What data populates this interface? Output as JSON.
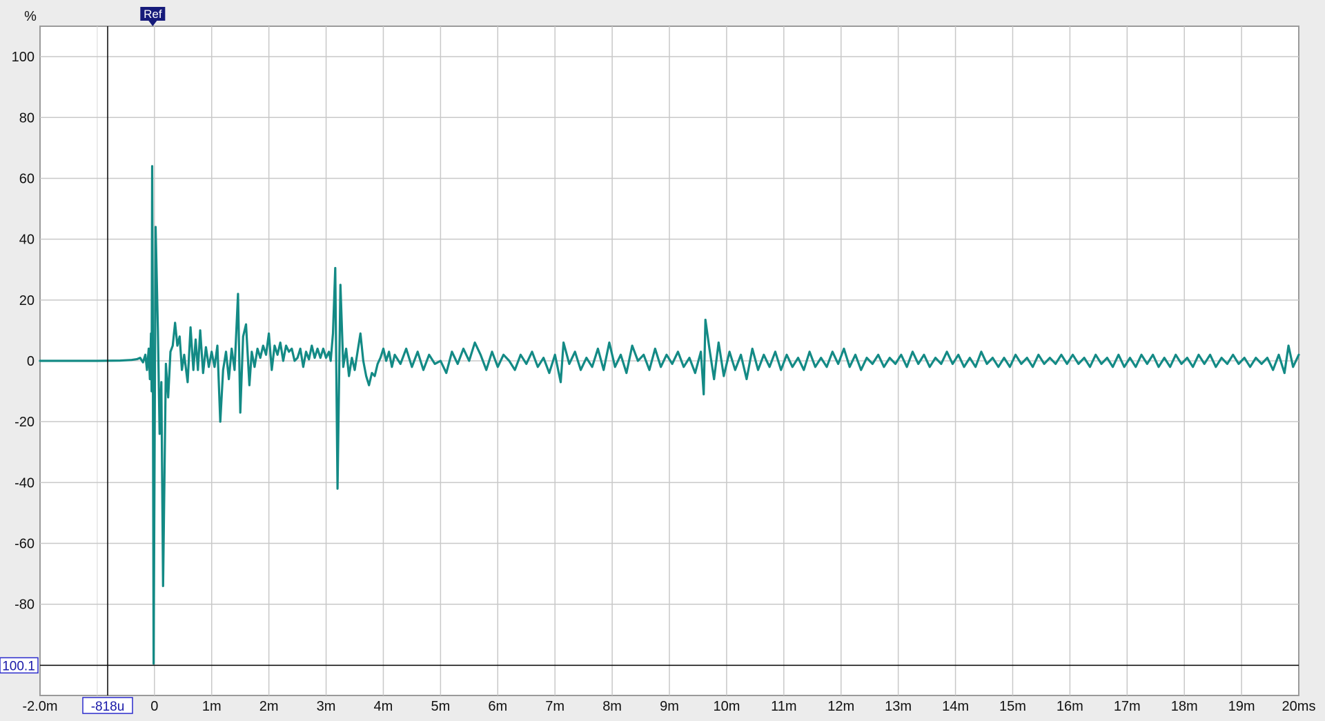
{
  "chart_data": {
    "type": "line",
    "title": "",
    "xlabel": "",
    "ylabel": "%",
    "xlim": [
      -2.0,
      20.0
    ],
    "ylim": [
      -110,
      110
    ],
    "grid": true,
    "x_unit": "ms",
    "x_ticks": [
      {
        "value": -2,
        "label": "-2.0m"
      },
      {
        "value": 0,
        "label": "0"
      },
      {
        "value": 1,
        "label": "1m"
      },
      {
        "value": 2,
        "label": "2m"
      },
      {
        "value": 3,
        "label": "3m"
      },
      {
        "value": 4,
        "label": "4m"
      },
      {
        "value": 5,
        "label": "5m"
      },
      {
        "value": 6,
        "label": "6m"
      },
      {
        "value": 7,
        "label": "7m"
      },
      {
        "value": 8,
        "label": "8m"
      },
      {
        "value": 9,
        "label": "9m"
      },
      {
        "value": 10,
        "label": "10m"
      },
      {
        "value": 11,
        "label": "11m"
      },
      {
        "value": 12,
        "label": "12m"
      },
      {
        "value": 13,
        "label": "13m"
      },
      {
        "value": 14,
        "label": "14m"
      },
      {
        "value": 15,
        "label": "15m"
      },
      {
        "value": 16,
        "label": "16m"
      },
      {
        "value": 17,
        "label": "17m"
      },
      {
        "value": 18,
        "label": "18m"
      },
      {
        "value": 19,
        "label": "19m"
      },
      {
        "value": 20,
        "label": "20ms"
      }
    ],
    "y_ticks": [
      {
        "value": 100,
        "label": "100"
      },
      {
        "value": 80,
        "label": "80"
      },
      {
        "value": 60,
        "label": "60"
      },
      {
        "value": 40,
        "label": "40"
      },
      {
        "value": 20,
        "label": "20"
      },
      {
        "value": 0,
        "label": "0"
      },
      {
        "value": -20,
        "label": "-20"
      },
      {
        "value": -40,
        "label": "-40"
      },
      {
        "value": -60,
        "label": "-60"
      },
      {
        "value": -80,
        "label": "-80"
      }
    ],
    "cursor": {
      "x_value": -0.818,
      "x_label": "-818u",
      "y_value": -100.1,
      "y_label": "100.1"
    },
    "reference_marker": {
      "x_value": -0.03,
      "label": "Ref"
    },
    "series": [
      {
        "color": "#138a85",
        "points": [
          [
            -2.0,
            0
          ],
          [
            -1.5,
            0
          ],
          [
            -1.0,
            0
          ],
          [
            -0.6,
            0.1
          ],
          [
            -0.4,
            0.3
          ],
          [
            -0.3,
            0.6
          ],
          [
            -0.25,
            1.0
          ],
          [
            -0.2,
            -0.5
          ],
          [
            -0.16,
            2.0
          ],
          [
            -0.13,
            -3.0
          ],
          [
            -0.1,
            4.0
          ],
          [
            -0.08,
            -6.0
          ],
          [
            -0.06,
            9.0
          ],
          [
            -0.05,
            -10.0
          ],
          [
            -0.04,
            64.0
          ],
          [
            -0.03,
            20.0
          ],
          [
            -0.015,
            -99.5
          ],
          [
            0.02,
            44.0
          ],
          [
            0.06,
            10.0
          ],
          [
            0.09,
            -24.0
          ],
          [
            0.12,
            -7.0
          ],
          [
            0.15,
            -74.0
          ],
          [
            0.2,
            -1.0
          ],
          [
            0.24,
            -12.0
          ],
          [
            0.28,
            3.0
          ],
          [
            0.32,
            5.0
          ],
          [
            0.36,
            12.5
          ],
          [
            0.4,
            5.0
          ],
          [
            0.44,
            8.0
          ],
          [
            0.48,
            -3.0
          ],
          [
            0.52,
            2.0
          ],
          [
            0.58,
            -7.0
          ],
          [
            0.63,
            11.0
          ],
          [
            0.68,
            -3.0
          ],
          [
            0.72,
            7.0
          ],
          [
            0.76,
            -3.0
          ],
          [
            0.8,
            10.0
          ],
          [
            0.85,
            -4.0
          ],
          [
            0.9,
            4.5
          ],
          [
            0.95,
            -2.0
          ],
          [
            1.0,
            3.0
          ],
          [
            1.05,
            -2.0
          ],
          [
            1.1,
            5.0
          ],
          [
            1.15,
            -20.0
          ],
          [
            1.2,
            -3.0
          ],
          [
            1.25,
            3.0
          ],
          [
            1.3,
            -6.0
          ],
          [
            1.35,
            4.0
          ],
          [
            1.4,
            -3.0
          ],
          [
            1.46,
            22.0
          ],
          [
            1.5,
            -17.0
          ],
          [
            1.55,
            8.0
          ],
          [
            1.6,
            12.0
          ],
          [
            1.66,
            -8.0
          ],
          [
            1.7,
            3.0
          ],
          [
            1.75,
            -2.0
          ],
          [
            1.8,
            4.0
          ],
          [
            1.85,
            1.0
          ],
          [
            1.9,
            5.0
          ],
          [
            1.95,
            2.0
          ],
          [
            2.0,
            9.0
          ],
          [
            2.05,
            -3.0
          ],
          [
            2.1,
            5.0
          ],
          [
            2.15,
            2.0
          ],
          [
            2.2,
            6.0
          ],
          [
            2.25,
            0.0
          ],
          [
            2.3,
            5.0
          ],
          [
            2.35,
            3.0
          ],
          [
            2.4,
            4.0
          ],
          [
            2.45,
            0.0
          ],
          [
            2.5,
            1.0
          ],
          [
            2.55,
            4.0
          ],
          [
            2.6,
            -2.0
          ],
          [
            2.65,
            3.0
          ],
          [
            2.7,
            0.5
          ],
          [
            2.75,
            5.0
          ],
          [
            2.8,
            1.0
          ],
          [
            2.85,
            4.0
          ],
          [
            2.9,
            1.0
          ],
          [
            2.95,
            4.0
          ],
          [
            3.0,
            1.0
          ],
          [
            3.05,
            3.0
          ],
          [
            3.08,
            0.0
          ],
          [
            3.12,
            9.0
          ],
          [
            3.16,
            30.5
          ],
          [
            3.2,
            -42.0
          ],
          [
            3.25,
            25.0
          ],
          [
            3.3,
            -2.0
          ],
          [
            3.35,
            4.0
          ],
          [
            3.4,
            -5.0
          ],
          [
            3.45,
            1.0
          ],
          [
            3.5,
            -3.0
          ],
          [
            3.55,
            3.0
          ],
          [
            3.6,
            9.0
          ],
          [
            3.65,
            0.0
          ],
          [
            3.7,
            -5.0
          ],
          [
            3.75,
            -8.0
          ],
          [
            3.8,
            -4.0
          ],
          [
            3.85,
            -5.0
          ],
          [
            3.9,
            -1.0
          ],
          [
            3.95,
            1.0
          ],
          [
            4.0,
            4.0
          ],
          [
            4.05,
            0.0
          ],
          [
            4.1,
            3.0
          ],
          [
            4.15,
            -2.0
          ],
          [
            4.2,
            2.0
          ],
          [
            4.3,
            -1.0
          ],
          [
            4.4,
            4.0
          ],
          [
            4.5,
            -2.0
          ],
          [
            4.6,
            3.0
          ],
          [
            4.7,
            -3.0
          ],
          [
            4.8,
            2.0
          ],
          [
            4.9,
            -1.0
          ],
          [
            5.0,
            0.0
          ],
          [
            5.1,
            -4.0
          ],
          [
            5.2,
            3.0
          ],
          [
            5.3,
            -1.0
          ],
          [
            5.4,
            4.0
          ],
          [
            5.5,
            0.0
          ],
          [
            5.6,
            6.0
          ],
          [
            5.7,
            2.0
          ],
          [
            5.8,
            -3.0
          ],
          [
            5.9,
            3.0
          ],
          [
            6.0,
            -2.0
          ],
          [
            6.1,
            2.0
          ],
          [
            6.2,
            0.0
          ],
          [
            6.3,
            -3.0
          ],
          [
            6.4,
            2.0
          ],
          [
            6.5,
            -1.0
          ],
          [
            6.6,
            3.0
          ],
          [
            6.7,
            -2.0
          ],
          [
            6.8,
            1.0
          ],
          [
            6.9,
            -4.0
          ],
          [
            7.0,
            2.0
          ],
          [
            7.1,
            -7.0
          ],
          [
            7.15,
            6.0
          ],
          [
            7.25,
            -1.0
          ],
          [
            7.35,
            3.0
          ],
          [
            7.45,
            -3.0
          ],
          [
            7.55,
            1.0
          ],
          [
            7.65,
            -2.0
          ],
          [
            7.75,
            4.0
          ],
          [
            7.85,
            -3.0
          ],
          [
            7.95,
            6.0
          ],
          [
            8.05,
            -2.0
          ],
          [
            8.15,
            2.0
          ],
          [
            8.25,
            -4.0
          ],
          [
            8.35,
            5.0
          ],
          [
            8.45,
            0.0
          ],
          [
            8.55,
            2.0
          ],
          [
            8.65,
            -3.0
          ],
          [
            8.75,
            4.0
          ],
          [
            8.85,
            -2.0
          ],
          [
            8.95,
            2.0
          ],
          [
            9.05,
            -1.0
          ],
          [
            9.15,
            3.0
          ],
          [
            9.25,
            -2.0
          ],
          [
            9.35,
            1.0
          ],
          [
            9.45,
            -4.0
          ],
          [
            9.55,
            3.0
          ],
          [
            9.6,
            -11.0
          ],
          [
            9.63,
            13.5
          ],
          [
            9.7,
            4.0
          ],
          [
            9.78,
            -6.0
          ],
          [
            9.86,
            6.0
          ],
          [
            9.95,
            -5.0
          ],
          [
            10.05,
            3.0
          ],
          [
            10.15,
            -3.0
          ],
          [
            10.25,
            2.0
          ],
          [
            10.35,
            -6.0
          ],
          [
            10.45,
            4.0
          ],
          [
            10.55,
            -3.0
          ],
          [
            10.65,
            2.0
          ],
          [
            10.75,
            -2.0
          ],
          [
            10.85,
            3.0
          ],
          [
            10.95,
            -3.0
          ],
          [
            11.05,
            2.0
          ],
          [
            11.15,
            -2.0
          ],
          [
            11.25,
            1.0
          ],
          [
            11.35,
            -3.0
          ],
          [
            11.45,
            3.0
          ],
          [
            11.55,
            -2.0
          ],
          [
            11.65,
            1.0
          ],
          [
            11.75,
            -2.0
          ],
          [
            11.85,
            3.0
          ],
          [
            11.95,
            -1.0
          ],
          [
            12.05,
            4.0
          ],
          [
            12.15,
            -2.0
          ],
          [
            12.25,
            2.0
          ],
          [
            12.35,
            -3.0
          ],
          [
            12.45,
            1.0
          ],
          [
            12.55,
            -1.0
          ],
          [
            12.65,
            2.0
          ],
          [
            12.75,
            -2.0
          ],
          [
            12.85,
            1.0
          ],
          [
            12.95,
            -1.0
          ],
          [
            13.05,
            2.0
          ],
          [
            13.15,
            -2.0
          ],
          [
            13.25,
            3.0
          ],
          [
            13.35,
            -1.0
          ],
          [
            13.45,
            2.0
          ],
          [
            13.55,
            -2.0
          ],
          [
            13.65,
            1.0
          ],
          [
            13.75,
            -1.0
          ],
          [
            13.85,
            3.0
          ],
          [
            13.95,
            -1.0
          ],
          [
            14.05,
            2.0
          ],
          [
            14.15,
            -2.0
          ],
          [
            14.25,
            1.0
          ],
          [
            14.35,
            -2.0
          ],
          [
            14.45,
            3.0
          ],
          [
            14.55,
            -1.0
          ],
          [
            14.65,
            1.0
          ],
          [
            14.75,
            -2.0
          ],
          [
            14.85,
            1.0
          ],
          [
            14.95,
            -2.0
          ],
          [
            15.05,
            2.0
          ],
          [
            15.15,
            -1.0
          ],
          [
            15.25,
            1.0
          ],
          [
            15.35,
            -2.0
          ],
          [
            15.45,
            2.0
          ],
          [
            15.55,
            -1.0
          ],
          [
            15.65,
            1.0
          ],
          [
            15.75,
            -1.0
          ],
          [
            15.85,
            2.0
          ],
          [
            15.95,
            -1.0
          ],
          [
            16.05,
            2.0
          ],
          [
            16.15,
            -1.0
          ],
          [
            16.25,
            1.0
          ],
          [
            16.35,
            -2.0
          ],
          [
            16.45,
            2.0
          ],
          [
            16.55,
            -1.0
          ],
          [
            16.65,
            1.0
          ],
          [
            16.75,
            -2.0
          ],
          [
            16.85,
            2.0
          ],
          [
            16.95,
            -2.0
          ],
          [
            17.05,
            1.0
          ],
          [
            17.15,
            -2.0
          ],
          [
            17.25,
            2.0
          ],
          [
            17.35,
            -1.0
          ],
          [
            17.45,
            2.0
          ],
          [
            17.55,
            -2.0
          ],
          [
            17.65,
            1.0
          ],
          [
            17.75,
            -2.0
          ],
          [
            17.85,
            2.0
          ],
          [
            17.95,
            -1.0
          ],
          [
            18.05,
            1.0
          ],
          [
            18.15,
            -2.0
          ],
          [
            18.25,
            2.0
          ],
          [
            18.35,
            -1.0
          ],
          [
            18.45,
            2.0
          ],
          [
            18.55,
            -2.0
          ],
          [
            18.65,
            1.0
          ],
          [
            18.75,
            -1.0
          ],
          [
            18.85,
            2.0
          ],
          [
            18.95,
            -1.0
          ],
          [
            19.05,
            1.0
          ],
          [
            19.15,
            -2.0
          ],
          [
            19.25,
            1.0
          ],
          [
            19.35,
            -1.0
          ],
          [
            19.45,
            1.0
          ],
          [
            19.55,
            -3.0
          ],
          [
            19.65,
            2.0
          ],
          [
            19.75,
            -4.0
          ],
          [
            19.82,
            5.0
          ],
          [
            19.9,
            -2.0
          ],
          [
            20.0,
            2.0
          ]
        ]
      }
    ]
  }
}
